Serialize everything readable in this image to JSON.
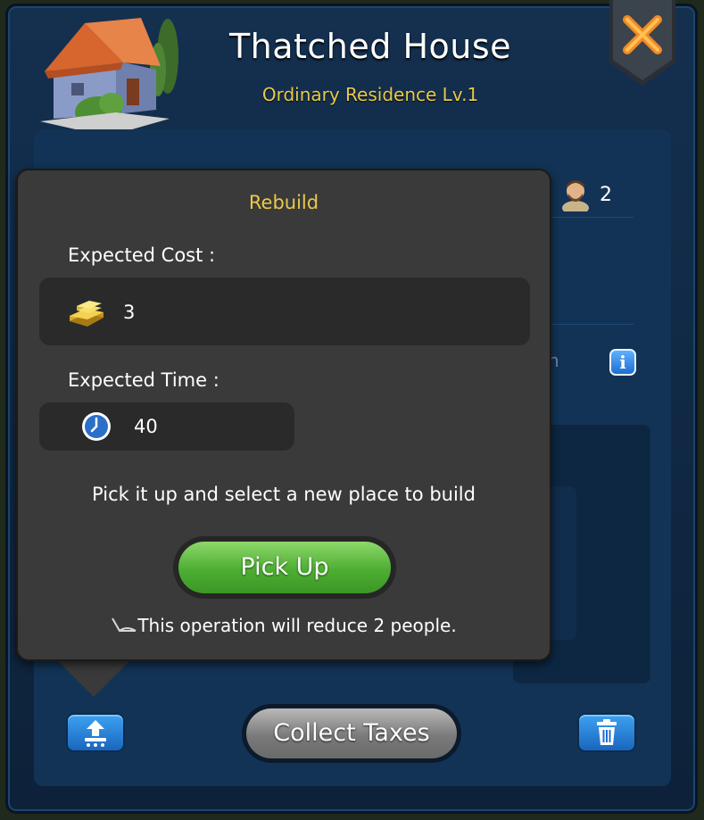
{
  "building": {
    "name": "Thatched House",
    "subtitle": "Ordinary Residence Lv.1",
    "population": "2",
    "partial_text": "n"
  },
  "info_icon_label": "i",
  "popup": {
    "title": "Rebuild",
    "cost_label": "Expected Cost :",
    "cost_value": "3",
    "time_label": "Expected Time :",
    "time_value": "40",
    "message": "Pick it up and select a new place to build",
    "pickup_label": "Pick Up",
    "warning": "This operation will reduce 2 people."
  },
  "bottom": {
    "collect_label": "Collect Taxes"
  },
  "icons": {
    "close": "close-x-icon",
    "population": "citizen-portrait-icon",
    "info": "info-icon",
    "gold": "gold-bars-icon",
    "clock": "clock-icon",
    "warning": "warning-icon",
    "move": "move-building-icon",
    "trash": "trash-icon"
  },
  "colors": {
    "panel": "#123355",
    "gold_text": "#e9c94a",
    "popup_bg": "#3a3a3a",
    "pickup_green": "#4cae32",
    "button_blue": "#1e6fd1"
  }
}
